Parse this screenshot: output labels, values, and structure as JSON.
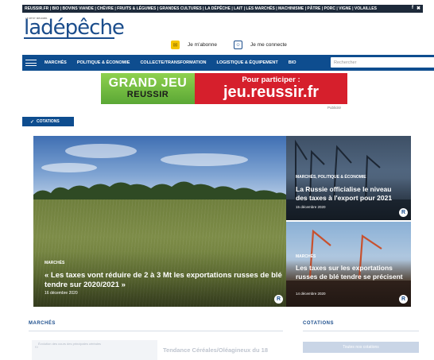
{
  "topbar": {
    "links": "REUSSIR.FR | BIO | BOVINS VIANDE | CHÈVRE | FRUITS & LÉGUMES | GRANDES CULTURES | LA DÉPÊCHE | LAIT | LES MARCHÉS | MACHINISME | PÂTRE | PORC | VIGNE | VOLAILLES",
    "facebook_icon": "f",
    "twitter_icon": "✖"
  },
  "brand": {
    "logo": "ladépêche",
    "kicker": "LE PETIT MEUNIER"
  },
  "header": {
    "subscribe_label": "Je m'abonne",
    "login_label": "Je me connecte",
    "subscribe_icon": "✉",
    "login_icon": "☺"
  },
  "nav": {
    "items": [
      "MARCHÉS",
      "POLITIQUE & ÉCONOMIE",
      "COLLECTE/TRANSFORMATION",
      "LOGISTIQUE & ÉQUIPEMENT",
      "BIO"
    ],
    "search_placeholder": "Rechercher",
    "search_icon": "⌕"
  },
  "banner": {
    "left_line1": "GRAND JEU",
    "left_line2": "REUSSIR",
    "right_line1": "Pour participer :",
    "right_line2": "jeu.reussir.fr",
    "label": "Publicité"
  },
  "cotations_tab": {
    "label": "COTATIONS",
    "icon": "✓"
  },
  "hero": {
    "category": "MARCHÉS",
    "title": "« Les taxes vont réduire de 2 à 3 Mt les exportations russes de blé tendre sur 2020/2021 »",
    "date": "16 décembre 2020",
    "badge": "R"
  },
  "cards": [
    {
      "category": "MARCHÉS, POLITIQUE & ÉCONOMIE",
      "title": "La Russie officialise le niveau des taxes à l'export pour 2021",
      "date": "15 décembre 2020",
      "badge": "R"
    },
    {
      "category": "MARCHÉS",
      "title": "Les taxes sur les exportations russes de blé tendre se précisent",
      "date": "14 décembre 2020",
      "badge": "R"
    }
  ],
  "sections": {
    "marches_label": "MARCHÉS",
    "cotations_label": "COTATIONS",
    "thumb_caption": "Évolution des cours des principales céréales",
    "thumb_value": "€/t",
    "article_title": "Tendance Céréales/Oléagineux du 18",
    "cotations_button": "Toutes nos cotations"
  }
}
